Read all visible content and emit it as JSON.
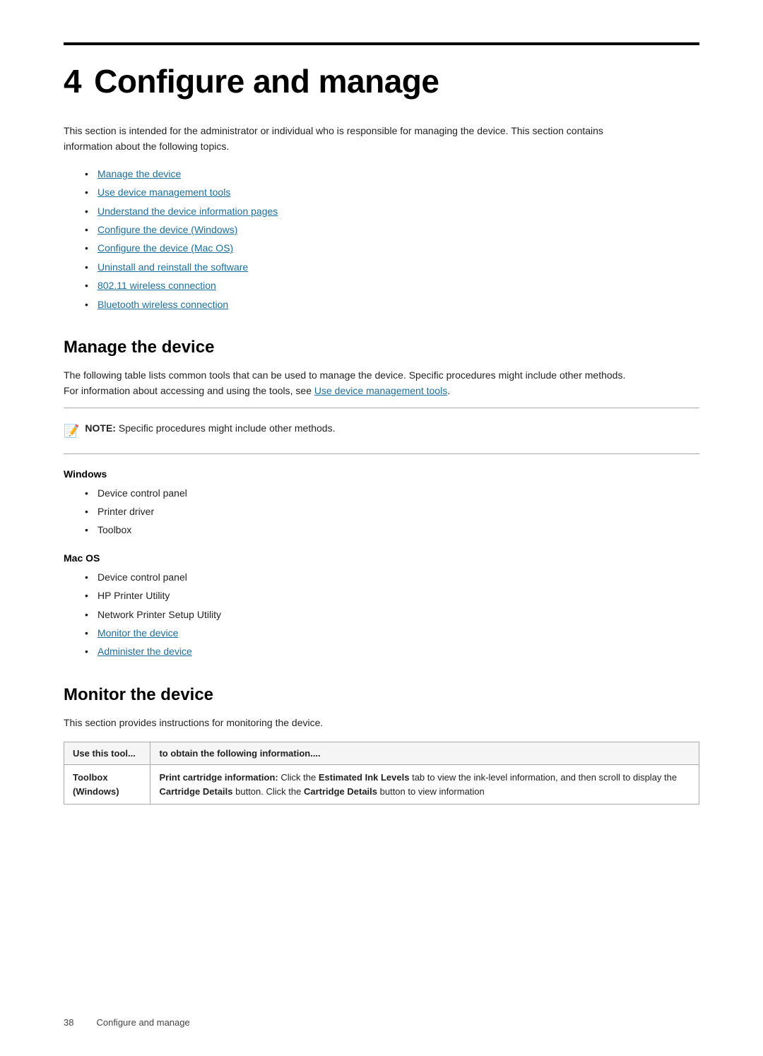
{
  "page": {
    "top_border": true,
    "chapter_number": "4",
    "chapter_title": "Configure and manage",
    "intro_paragraph": "This section is intended for the administrator or individual who is responsible for managing the device. This section contains information about the following topics.",
    "toc_links": [
      {
        "text": "Manage the device",
        "href": "#manage"
      },
      {
        "text": "Use device management tools",
        "href": "#tools"
      },
      {
        "text": "Understand the device information pages",
        "href": "#info-pages"
      },
      {
        "text": "Configure the device (Windows)",
        "href": "#config-windows"
      },
      {
        "text": "Configure the device (Mac OS)",
        "href": "#config-macos"
      },
      {
        "text": "Uninstall and reinstall the software",
        "href": "#uninstall"
      },
      {
        "text": "802.11 wireless connection",
        "href": "#wireless"
      },
      {
        "text": "Bluetooth wireless connection",
        "href": "#bluetooth"
      }
    ],
    "manage_section": {
      "title": "Manage the device",
      "body1": "The following table lists common tools that can be used to manage the device. Specific procedures might include other methods. For information about accessing and using the tools, see ",
      "body1_link_text": "Use device management tools",
      "body1_link_href": "#tools",
      "body1_end": ".",
      "note_label": "NOTE:",
      "note_text": "Specific procedures might include other methods.",
      "windows_title": "Windows",
      "windows_items": [
        "Device control panel",
        "Printer driver",
        "Toolbox"
      ],
      "macos_title": "Mac OS",
      "macos_items": [
        "Device control panel",
        "HP Printer Utility",
        "Network Printer Setup Utility"
      ],
      "macos_links": [
        {
          "text": "Monitor the device",
          "href": "#monitor"
        },
        {
          "text": "Administer the device",
          "href": "#administer"
        }
      ]
    },
    "monitor_section": {
      "title": "Monitor the device",
      "body": "This section provides instructions for monitoring the device.",
      "table": {
        "col1_header": "Use this tool...",
        "col2_header": "to obtain the following information....",
        "rows": [
          {
            "col1": "Toolbox (Windows)",
            "col2_parts": [
              {
                "bold": true,
                "text": "Print cartridge information:"
              },
              {
                "bold": false,
                "text": " Click the "
              },
              {
                "bold": true,
                "text": "Estimated Ink Levels"
              },
              {
                "bold": false,
                "text": " tab to view the ink-level information, and then scroll to display the "
              },
              {
                "bold": true,
                "text": "Cartridge Details"
              },
              {
                "bold": false,
                "text": " button. Click the "
              },
              {
                "bold": true,
                "text": "Cartridge Details"
              },
              {
                "bold": false,
                "text": " button to view information"
              }
            ]
          }
        ]
      }
    },
    "footer": {
      "page_number": "38",
      "title": "Configure and manage"
    }
  }
}
